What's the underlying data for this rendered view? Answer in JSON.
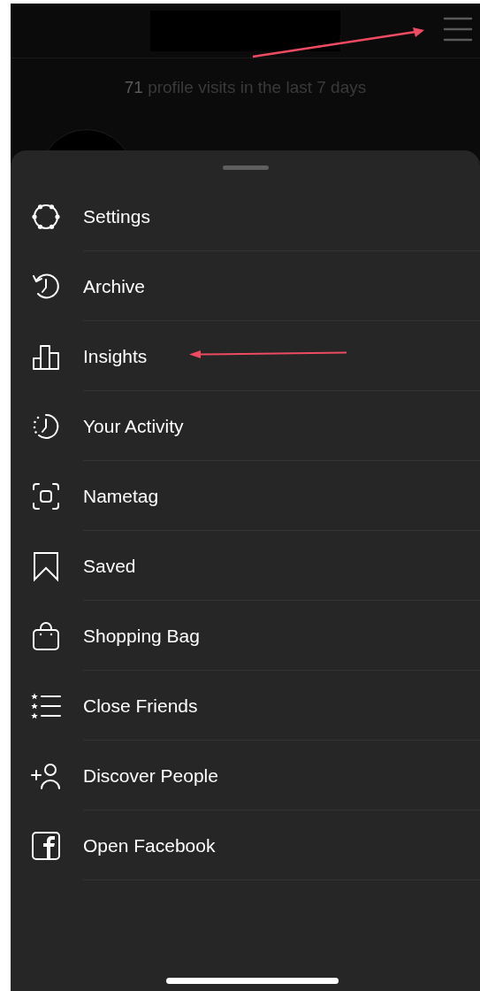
{
  "header": {
    "visits_count": "71",
    "visits_text": "profile visits in the last 7 days"
  },
  "menu": {
    "items": [
      {
        "label": "Settings"
      },
      {
        "label": "Archive"
      },
      {
        "label": "Insights"
      },
      {
        "label": "Your Activity"
      },
      {
        "label": "Nametag"
      },
      {
        "label": "Saved"
      },
      {
        "label": "Shopping Bag"
      },
      {
        "label": "Close Friends"
      },
      {
        "label": "Discover People"
      },
      {
        "label": "Open Facebook"
      }
    ]
  }
}
